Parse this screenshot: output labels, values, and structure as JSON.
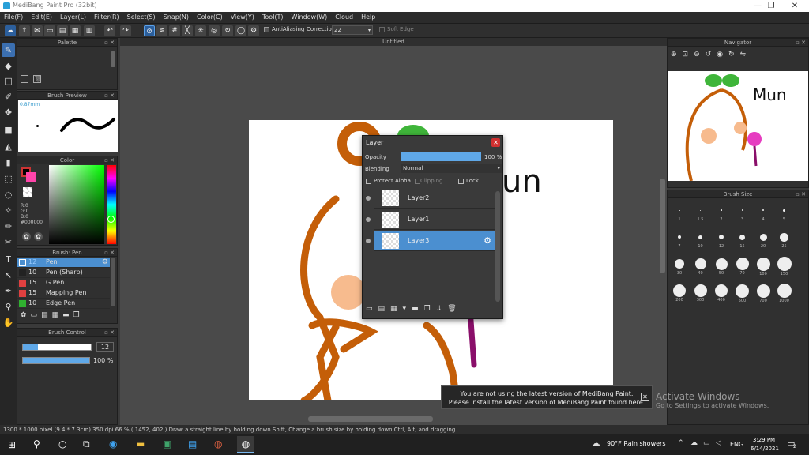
{
  "window": {
    "title": "MediBang Paint Pro (32bit)",
    "minimize": "—",
    "maximize": "❐",
    "close": "✕"
  },
  "menu": [
    "File(F)",
    "Edit(E)",
    "Layer(L)",
    "Filter(R)",
    "Select(S)",
    "Snap(N)",
    "Color(C)",
    "View(Y)",
    "Tool(T)",
    "Window(W)",
    "Cloud",
    "Help"
  ],
  "toolbar": {
    "antialiasing": "AntiAliasing",
    "correction_label": "Correction",
    "correction_value": "22",
    "soft_edge": "Soft Edge"
  },
  "panels": {
    "palette": "Palette",
    "brush_preview": "Brush Preview",
    "brush_preview_size": "0.87mm",
    "color": "Color",
    "color_values": {
      "r": "R:0",
      "g": "G:0",
      "b": "B:0",
      "hex": "#000000"
    },
    "brush_pen": "Brush: Pen",
    "brush_control": "Brush Control",
    "brush_size_value": "12",
    "opacity_value": "100 %",
    "navigator": "Navigator",
    "brush_size": "Brush Size",
    "canvas_tab": "Untitled"
  },
  "brushes": [
    {
      "size": "12",
      "name": "Pen",
      "color": "#4b8fd0",
      "selected": true
    },
    {
      "size": "10",
      "name": "Pen (Sharp)",
      "color": "#2b2b2b",
      "selected": false
    },
    {
      "size": "15",
      "name": "G Pen",
      "color": "#e04040",
      "selected": false
    },
    {
      "size": "15",
      "name": "Mapping Pen",
      "color": "#e04040",
      "selected": false
    },
    {
      "size": "10",
      "name": "Edge Pen",
      "color": "#30b030",
      "selected": false
    }
  ],
  "brush_sizes": [
    "1",
    "1.5",
    "2",
    "3",
    "4",
    "5",
    "7",
    "10",
    "12",
    "15",
    "20",
    "25",
    "30",
    "40",
    "50",
    "70",
    "100",
    "150",
    "200",
    "300",
    "400",
    "500",
    "700",
    "1000"
  ],
  "layer_panel": {
    "title": "Layer",
    "opacity_label": "Opacity",
    "opacity_value": "100 %",
    "blending_label": "Blending",
    "blending_value": "Normal",
    "protect_alpha": "Protect Alpha",
    "clipping": "Clipping",
    "lock": "Lock",
    "layers": [
      "Layer2",
      "Layer1",
      "Layer3"
    ]
  },
  "status": "1300 * 1000 pixel   (9.4 * 7.3cm)   350 dpi   66 %   ( 1452, 402 )   Draw a straight line by holding down Shift, Change a brush size by holding down Ctrl, Alt, and dragging",
  "notification": {
    "line1": "You are not using the latest version of MediBang Paint.",
    "line2": "Please install the latest version of MediBang Paint found here."
  },
  "activate": {
    "title": "Activate Windows",
    "sub": "Go to Settings to activate Windows."
  },
  "taskbar": {
    "weather": "90°F  Rain showers",
    "lang": "ENG",
    "time": "3:29 PM",
    "date": "6/14/2021",
    "notif_count": "2"
  },
  "drawing_text": "Mun",
  "drawing_text_canvas": "un"
}
